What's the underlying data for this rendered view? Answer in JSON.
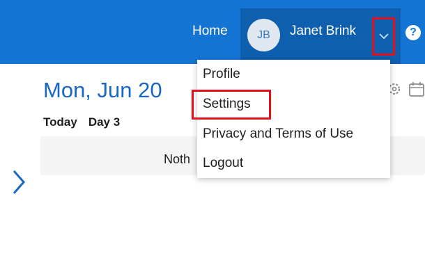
{
  "header": {
    "home_label": "Home",
    "avatar_initials": "JB",
    "user_name": "Janet Brink",
    "help_glyph": "?",
    "icons": [
      "chevron-down-icon",
      "help-icon"
    ]
  },
  "main": {
    "date_title": "Mon, Jun 20",
    "today_label": "Today",
    "day_label": "Day 3",
    "nothing_text": "Noth",
    "icons": [
      "gear-icon",
      "calendar-icon",
      "chevron-right-icon"
    ]
  },
  "dropdown": {
    "items": [
      {
        "label": "Profile"
      },
      {
        "label": "Settings"
      },
      {
        "label": "Privacy and Terms of Use"
      },
      {
        "label": "Logout"
      }
    ]
  },
  "colors": {
    "header_bg": "#1474d4",
    "user_block_bg": "#0e5fae",
    "title_blue": "#1967c2",
    "highlight_red": "#e3101b"
  }
}
